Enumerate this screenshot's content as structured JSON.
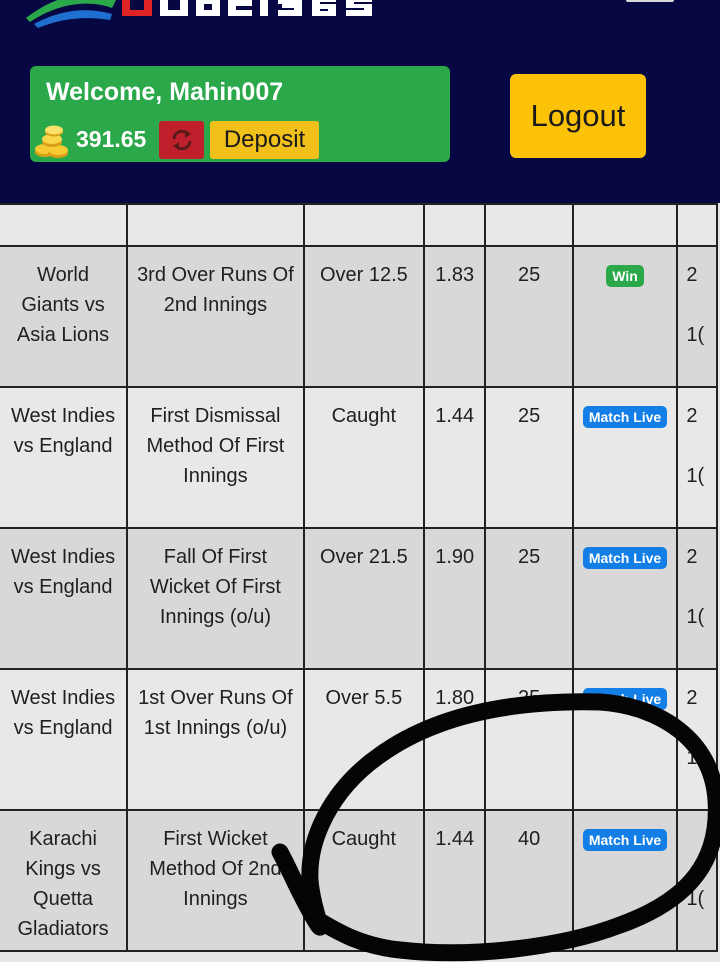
{
  "header": {
    "welcome": "Welcome, Mahin007",
    "balance": "391.65",
    "deposit_label": "Deposit",
    "logout_label": "Logout",
    "coin_icon": "coins-icon",
    "refresh_icon": "refresh-icon"
  },
  "colors": {
    "header_bg": "#070744",
    "welcome_bg": "#2aa84a",
    "refresh_bg": "#c0202c",
    "deposit_bg": "#f2c01b",
    "logout_bg": "#fcc207",
    "win_badge": "#2aa84a",
    "live_badge": "#137ee6"
  },
  "bets": [
    {
      "match": "World Giants vs Asia Lions",
      "market": "3rd Over Runs Of 2nd Innings",
      "selection": "Over 12.5",
      "odds": "1.83",
      "stake": "25",
      "status": "Win",
      "next_col_top": "2",
      "next_col_bottom": "1("
    },
    {
      "match": "West Indies vs England",
      "market": "First Dismissal Method Of First Innings",
      "selection": "Caught",
      "odds": "1.44",
      "stake": "25",
      "status": "Match Live",
      "next_col_top": "2",
      "next_col_bottom": "1("
    },
    {
      "match": "West Indies vs England",
      "market": "Fall Of First Wicket Of First Innings (o/u)",
      "selection": "Over 21.5",
      "odds": "1.90",
      "stake": "25",
      "status": "Match Live",
      "next_col_top": "2",
      "next_col_bottom": "1("
    },
    {
      "match": "West Indies vs England",
      "market": "1st Over Runs Of 1st Innings (o/u)",
      "selection": "Over 5.5",
      "odds": "1.80",
      "stake": "25",
      "status": "Match Live",
      "next_col_top": "2",
      "next_col_bottom": "1("
    },
    {
      "match": "Karachi Kings vs Quetta Gladiators",
      "market": "First Wicket Method Of 2nd Innings",
      "selection": "Caught",
      "odds": "1.44",
      "stake": "40",
      "status": "Match Live",
      "next_col_top": "",
      "next_col_bottom": "1("
    }
  ]
}
